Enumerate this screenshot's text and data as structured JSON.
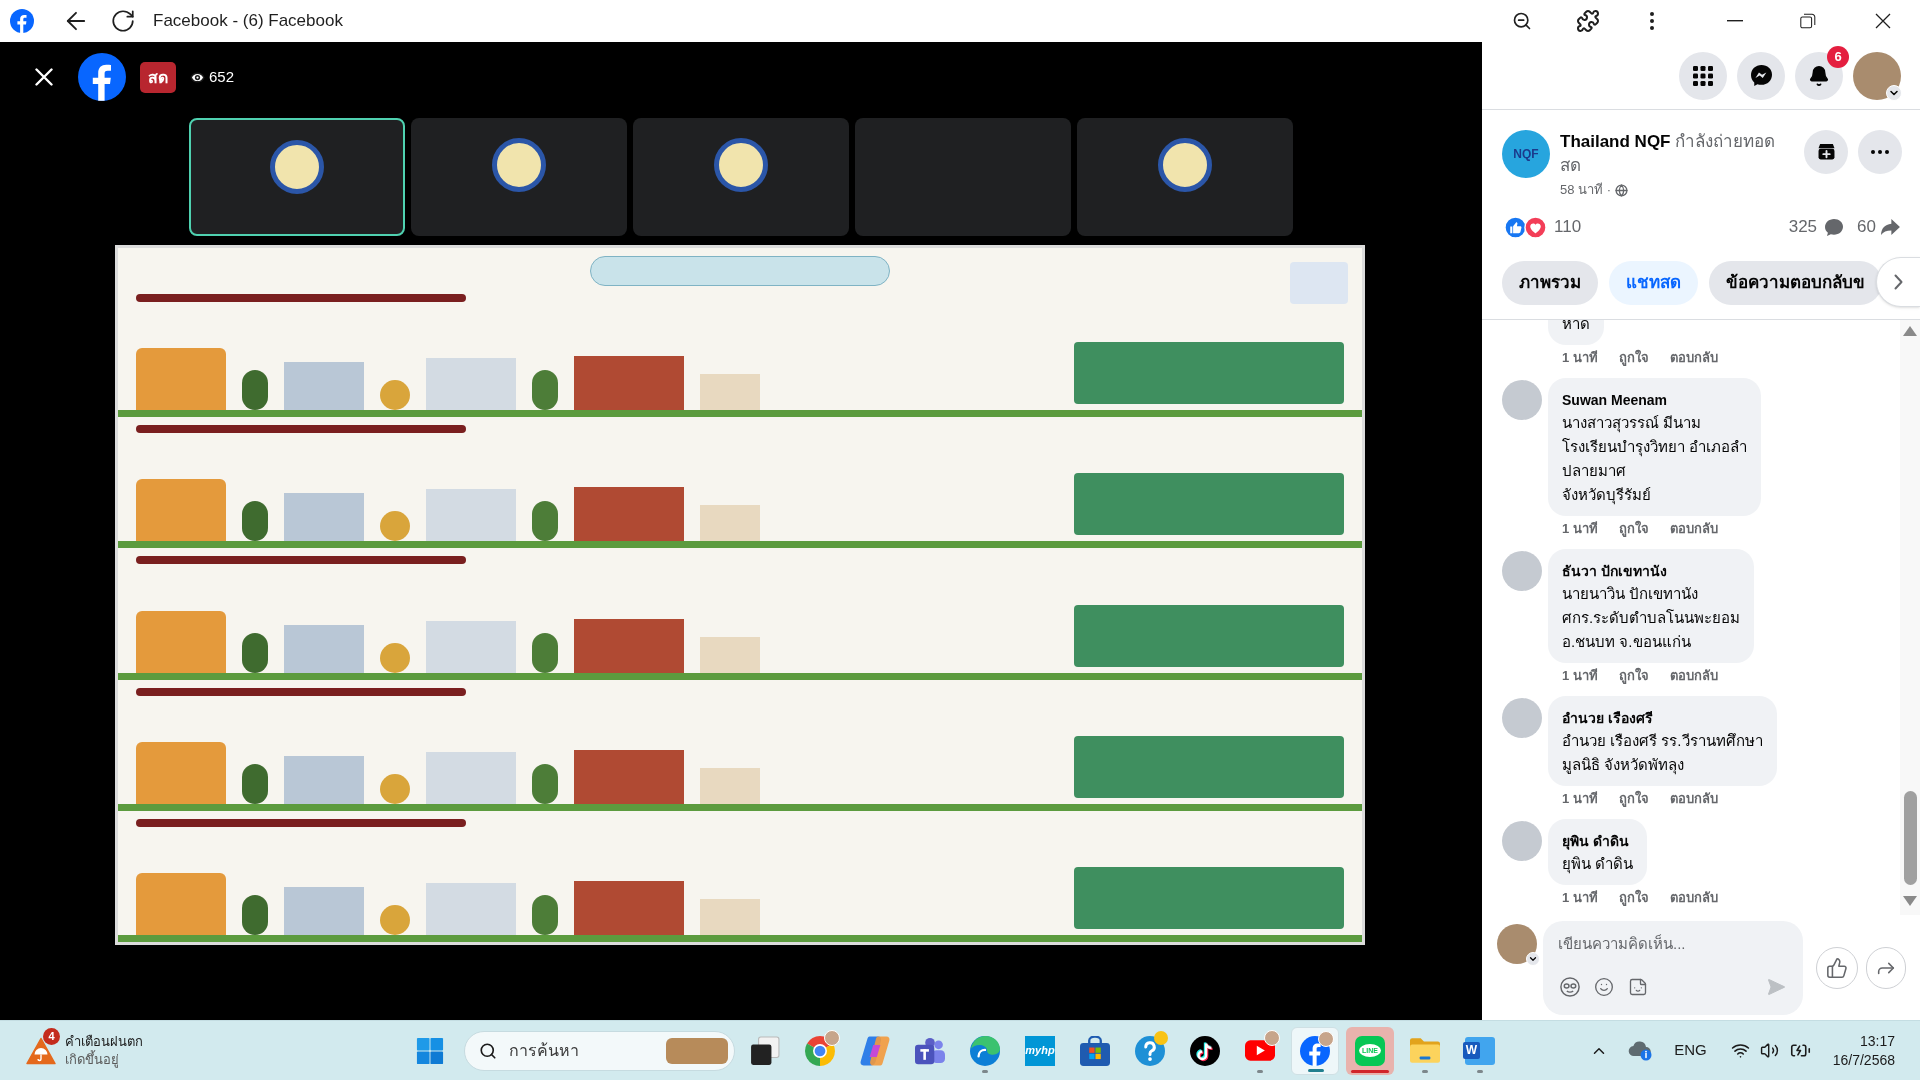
{
  "browser": {
    "title": "Facebook - (6) Facebook"
  },
  "live": {
    "badge": "สด",
    "views": "652"
  },
  "top_nav": {
    "notification_count": "6"
  },
  "post": {
    "logo_text": "NQF",
    "author": "Thailand NQF",
    "activity": "กำลังถ่ายทอดสด",
    "time": "58 นาที ·",
    "reactions": "110",
    "comments": "325",
    "shares": "60"
  },
  "tabs": [
    {
      "label": "ภาพรวม",
      "selected": false
    },
    {
      "label": "แชทสด",
      "selected": true
    },
    {
      "label": "ข้อความตอบกลับข",
      "selected": false
    }
  ],
  "comments": [
    {
      "lines": [
        "หาด"
      ],
      "time": "1 นาที",
      "like": "ถูกใจ",
      "reply": "ตอบกลับ"
    },
    {
      "author": "Suwan Meenam",
      "lines": [
        "นางสาวสุวรรณ์ มีนาม",
        "โรงเรียนบำรุงวิทยา อำเภอลำ",
        "ปลายมาศ",
        "จังหวัดบุรีรัมย์"
      ],
      "time": "1 นาที",
      "like": "ถูกใจ",
      "reply": "ตอบกลับ"
    },
    {
      "author": "ธันวา ปักเขทานัง",
      "lines": [
        "นายนาวิน ปักเขทานัง",
        "ศกร.ระดับตำบลโนนพะยอม",
        "อ.ชนบท จ.ขอนแก่น"
      ],
      "time": "1 นาที",
      "like": "ถูกใจ",
      "reply": "ตอบกลับ"
    },
    {
      "author": "อำนวย เรืองศรี",
      "lines": [
        "อำนวย เรืองศรี รร.วีรานทศึกษา",
        "มูลนิธิ จังหวัดพัทลุง"
      ],
      "time": "1 นาที",
      "like": "ถูกใจ",
      "reply": "ตอบกลับ"
    },
    {
      "author": "ยุพิน ดำดิน",
      "lines": [
        "ยุพิน ดำดิน"
      ],
      "time": "1 นาที",
      "like": "ถูกใจ",
      "reply": "ตอบกลับ"
    }
  ],
  "composer": {
    "placeholder": "เขียนความคิดเห็น...",
    "send_disabled": true
  },
  "taskbar": {
    "weather": {
      "badge": "4",
      "title": "คำเตือนฝนตก",
      "subtitle": "เกิดขึ้นอยู่"
    },
    "search_placeholder": "การค้นหา",
    "apps": [
      {
        "kind": "taskview",
        "running": false,
        "focused": false,
        "flashing": false,
        "profile_badge": false,
        "alert_dot": false
      },
      {
        "kind": "chrome",
        "running": false,
        "focused": false,
        "flashing": false,
        "profile_badge": true,
        "alert_dot": false
      },
      {
        "kind": "copilot",
        "running": false,
        "focused": false,
        "flashing": false,
        "profile_badge": false,
        "alert_dot": false
      },
      {
        "kind": "teams",
        "running": false,
        "focused": false,
        "flashing": false,
        "profile_badge": false,
        "alert_dot": false
      },
      {
        "kind": "edge",
        "running": true,
        "focused": false,
        "flashing": false,
        "profile_badge": false,
        "alert_dot": false
      },
      {
        "kind": "myhp",
        "glyph": "myhp",
        "running": false,
        "focused": false,
        "flashing": false,
        "profile_badge": false,
        "alert_dot": false
      },
      {
        "kind": "store",
        "running": false,
        "focused": false,
        "flashing": false,
        "profile_badge": false,
        "alert_dot": false
      },
      {
        "kind": "help",
        "running": false,
        "focused": false,
        "flashing": false,
        "profile_badge": false,
        "alert_dot": true
      },
      {
        "kind": "tiktok",
        "running": false,
        "focused": false,
        "flashing": false,
        "profile_badge": false,
        "alert_dot": false
      },
      {
        "kind": "youtube",
        "running": true,
        "focused": false,
        "flashing": false,
        "profile_badge": true,
        "alert_dot": false
      },
      {
        "kind": "facebook",
        "running": true,
        "focused": true,
        "flashing": false,
        "profile_badge": true,
        "alert_dot": false
      },
      {
        "kind": "line",
        "glyph": "LINE",
        "running": true,
        "focused": false,
        "flashing": true,
        "profile_badge": false,
        "alert_dot": false
      },
      {
        "kind": "explorer",
        "running": true,
        "focused": false,
        "flashing": false,
        "profile_badge": false,
        "alert_dot": false
      },
      {
        "kind": "word",
        "glyph": "W",
        "running": true,
        "focused": false,
        "flashing": false,
        "profile_badge": false,
        "alert_dot": false
      }
    ],
    "tray": {
      "language": "ENG",
      "time": "13:17",
      "date": "16/7/2568"
    }
  }
}
